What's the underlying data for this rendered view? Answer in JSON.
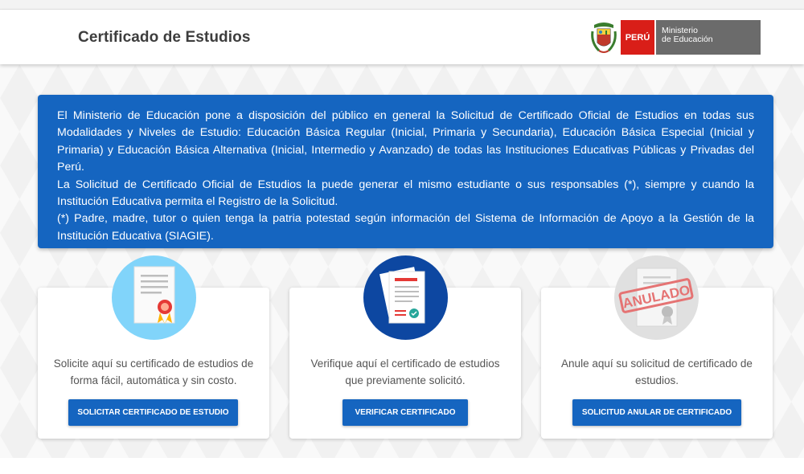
{
  "header": {
    "title": "Certificado de Estudios",
    "logo": {
      "country": "PERÚ",
      "ministry_line1": "Ministerio",
      "ministry_line2": "de Educación"
    }
  },
  "info_panel": {
    "paragraph1": "El Ministerio de Educación pone a disposición del público en general la Solicitud de Certificado Oficial de Estudios en todas sus Modalidades y Niveles de Estudio: Educación Básica Regular (Inicial, Primaria y Secundaria), Educación Básica Especial (Inicial y Primaria) y Educación Básica Alternativa (Inicial, Intermedio y Avanzado) de todas las Instituciones Educativas Públicas y Privadas del Perú.",
    "paragraph2": "La Solicitud de Certificado Oficial de Estudios la puede generar el mismo estudiante o sus responsables (*), siempre y cuando la Institución Educativa permita el Registro de la Solicitud.",
    "paragraph3": "(*) Padre, madre, tutor o quien tenga la patria potestad según información del Sistema de Información de Apoyo a la Gestión de la Institución Educativa (SIAGIE)."
  },
  "cards": [
    {
      "icon": "certificate-icon",
      "text": "Solicite aquí su certificado de estudios de forma fácil, automática y sin costo.",
      "button": "SOLICITAR CERTIFICADO DE ESTUDIO"
    },
    {
      "icon": "verify-document-icon",
      "text": "Verifique aquí el certificado de estudios que previamente solicitó.",
      "button": "VERIFICAR CERTIFICADO"
    },
    {
      "icon": "annulled-certificate-icon",
      "stamp": "ANULADO",
      "text": "Anule aquí su solicitud de certificado de estudios.",
      "button": "SOLICITUD ANULAR DE CERTIFICADO"
    }
  ],
  "colors": {
    "primary": "#1565c0",
    "peru_red": "#d91e18",
    "ministry_gray": "#6b6b6b",
    "icon1_bg": "#81d4fa",
    "icon2_bg": "#0d47a1",
    "icon3_bg": "#e0e0e0"
  }
}
